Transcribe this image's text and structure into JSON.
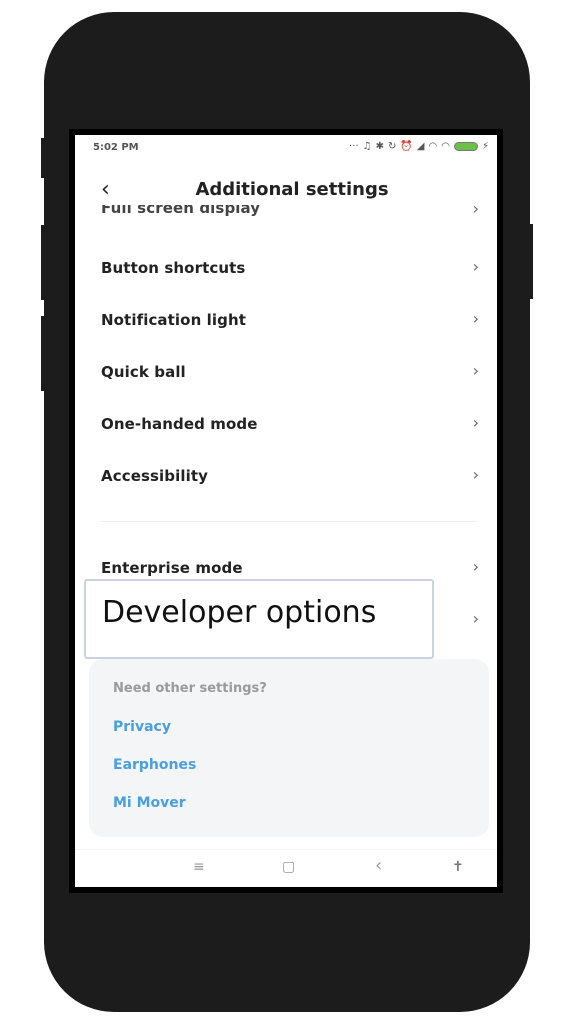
{
  "status_bar": {
    "time": "5:02 PM",
    "icons": [
      "more-notifications-icon",
      "headphones-icon",
      "bluetooth-icon",
      "sync-icon",
      "alarm-icon",
      "signal-icon",
      "wifi-icon",
      "wifi-icon",
      "battery-icon",
      "charging-icon"
    ],
    "battery_color": "#6cc04a"
  },
  "header": {
    "back_glyph": "‹",
    "title": "Additional settings"
  },
  "list": {
    "partial_item": "Full screen display",
    "items": [
      {
        "label": "Button shortcuts"
      },
      {
        "label": "Notification light"
      },
      {
        "label": "Quick ball"
      },
      {
        "label": "One-handed mode"
      },
      {
        "label": "Accessibility"
      }
    ],
    "section2": [
      {
        "label": "Enterprise mode"
      }
    ],
    "highlighted_item": {
      "label": "Developer options"
    },
    "chevron": "›"
  },
  "card": {
    "title": "Need other settings?",
    "links": [
      "Privacy",
      "Earphones",
      "Mi Mover"
    ],
    "link_color": "#4a9fdc"
  },
  "nav_bar": {
    "menu_glyph": "≡",
    "home_glyph": "▢",
    "back_glyph": "‹",
    "accessibility_glyph": "✝"
  }
}
